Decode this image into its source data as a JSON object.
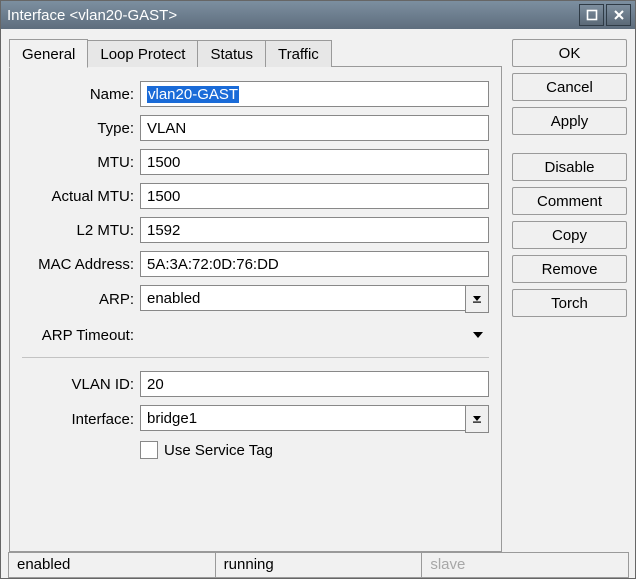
{
  "title": "Interface <vlan20-GAST>",
  "tabs": [
    "General",
    "Loop Protect",
    "Status",
    "Traffic"
  ],
  "active_tab": 0,
  "labels": {
    "name": "Name:",
    "type": "Type:",
    "mtu": "MTU:",
    "actual_mtu": "Actual MTU:",
    "l2_mtu": "L2 MTU:",
    "mac": "MAC Address:",
    "arp": "ARP:",
    "arp_timeout": "ARP Timeout:",
    "vlan_id": "VLAN ID:",
    "interface": "Interface:",
    "use_service_tag": "Use Service Tag"
  },
  "values": {
    "name": "vlan20-GAST",
    "type": "VLAN",
    "mtu": "1500",
    "actual_mtu": "1500",
    "l2_mtu": "1592",
    "mac": "5A:3A:72:0D:76:DD",
    "arp": "enabled",
    "arp_timeout": "",
    "vlan_id": "20",
    "interface": "bridge1",
    "use_service_tag": false
  },
  "buttons": {
    "ok": "OK",
    "cancel": "Cancel",
    "apply": "Apply",
    "disable": "Disable",
    "comment": "Comment",
    "copy": "Copy",
    "remove": "Remove",
    "torch": "Torch"
  },
  "status": {
    "s1": "enabled",
    "s2": "running",
    "s3": "slave"
  }
}
